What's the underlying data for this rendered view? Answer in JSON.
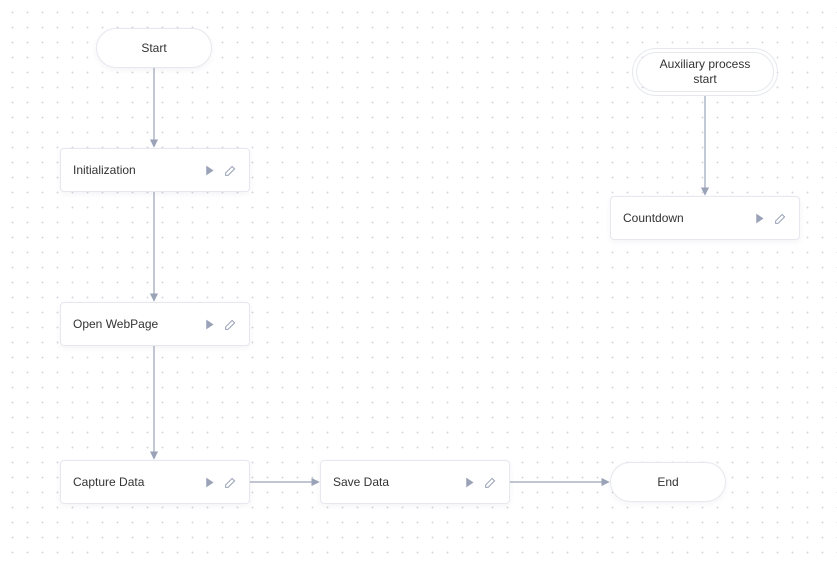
{
  "nodes": {
    "start": {
      "label": "Start"
    },
    "initialization": {
      "label": "Initialization"
    },
    "openWebPage": {
      "label": "Open WebPage"
    },
    "captureData": {
      "label": "Capture Data"
    },
    "saveData": {
      "label": "Save Data"
    },
    "end": {
      "label": "End"
    },
    "auxStart": {
      "label": "Auxiliary process start"
    },
    "countdown": {
      "label": "Countdown"
    }
  },
  "colors": {
    "arrow": "#9aa2b8",
    "icon": "#9aa2b8"
  }
}
